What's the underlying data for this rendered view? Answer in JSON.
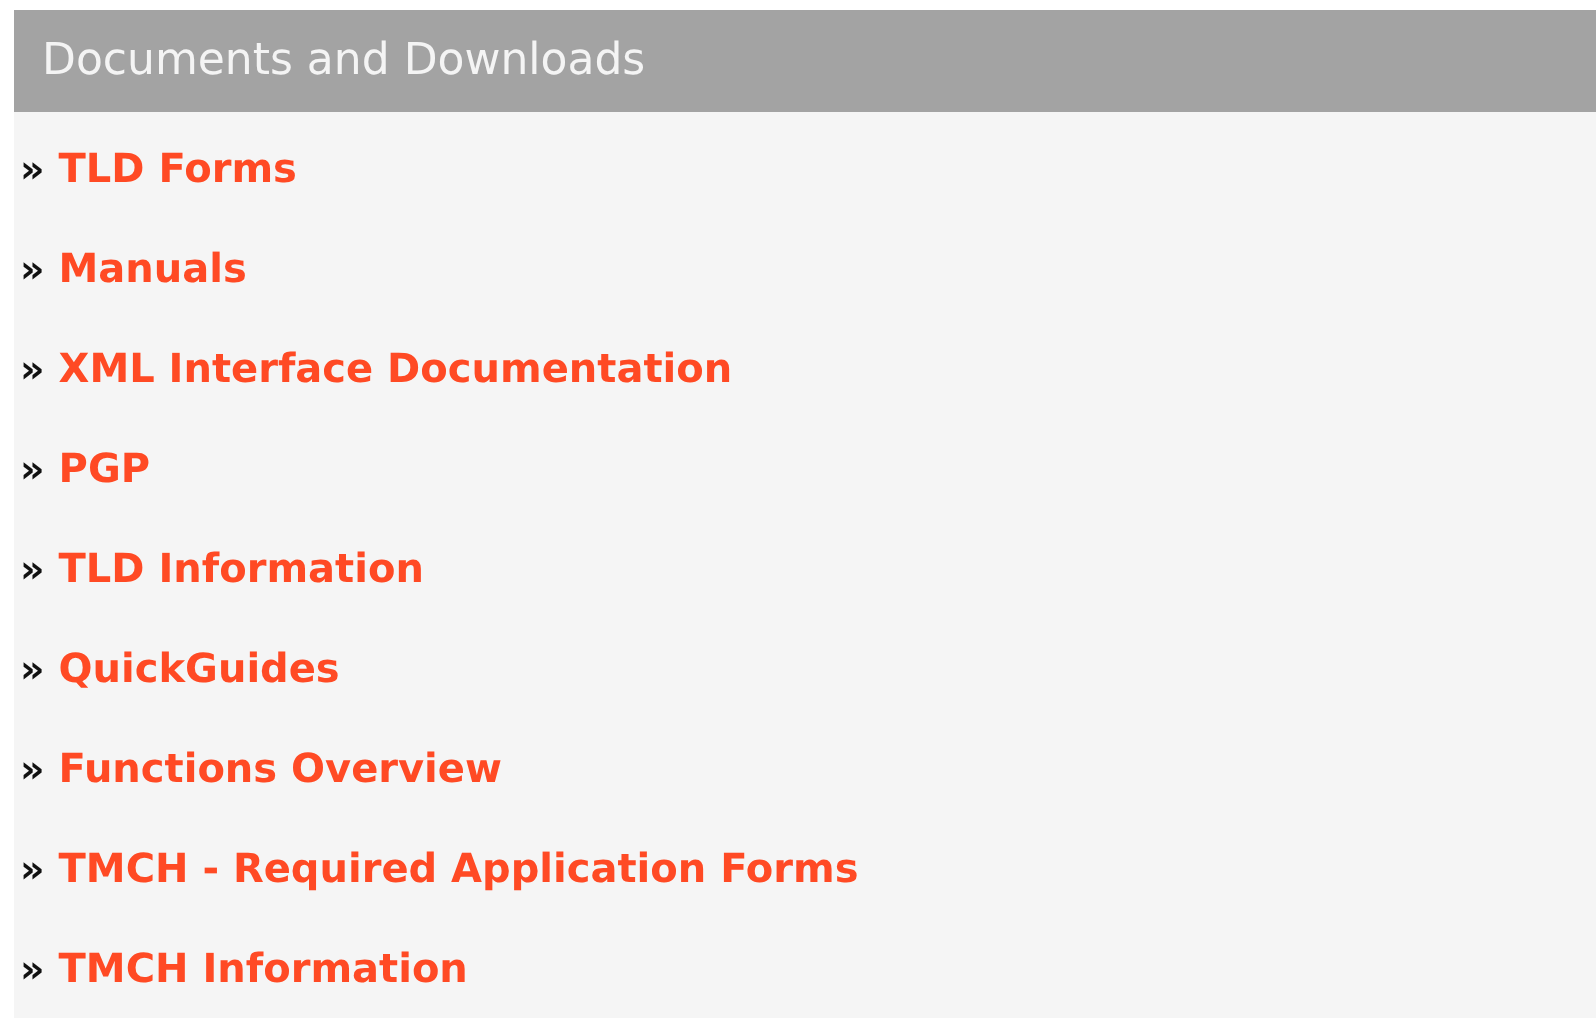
{
  "panel": {
    "title": "Documents and Downloads",
    "links": [
      {
        "bullet": "»",
        "label": "TLD Forms"
      },
      {
        "bullet": "»",
        "label": "Manuals"
      },
      {
        "bullet": "»",
        "label": "XML Interface Documentation"
      },
      {
        "bullet": "»",
        "label": "PGP"
      },
      {
        "bullet": "»",
        "label": "TLD Information"
      },
      {
        "bullet": "»",
        "label": "QuickGuides"
      },
      {
        "bullet": "»",
        "label": "Functions Overview"
      },
      {
        "bullet": "»",
        "label": "TMCH - Required Application Forms"
      },
      {
        "bullet": "»",
        "label": "TMCH Information"
      }
    ]
  }
}
